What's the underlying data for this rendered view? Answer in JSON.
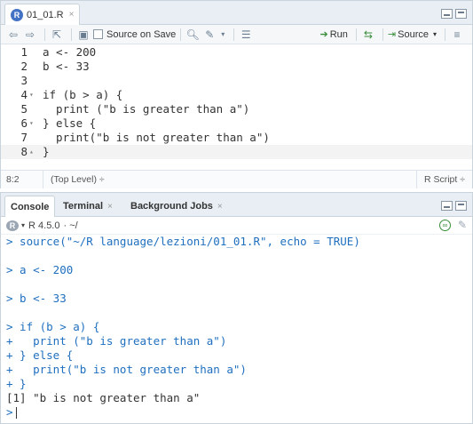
{
  "editor": {
    "tab_label": "01_01.R",
    "tab_close": "×",
    "toolbar": {
      "source_on_save_label": "Source on Save",
      "run_label": "Run",
      "source_label": "Source"
    },
    "lines": [
      {
        "num": "1",
        "fold": "",
        "text": "a <- 200"
      },
      {
        "num": "2",
        "fold": "",
        "text": "b <- 33"
      },
      {
        "num": "3",
        "fold": "",
        "text": ""
      },
      {
        "num": "4",
        "fold": "▾",
        "text": "if (b > a) {"
      },
      {
        "num": "5",
        "fold": "",
        "text": "  print (\"b is greater than a\")"
      },
      {
        "num": "6",
        "fold": "▾",
        "text": "} else {"
      },
      {
        "num": "7",
        "fold": "",
        "text": "  print(\"b is not greater than a\")"
      },
      {
        "num": "8",
        "fold": "▴",
        "text": "}"
      }
    ],
    "status": {
      "position": "8:2",
      "scope": "(Top Level) ÷",
      "file_type": "R Script ÷"
    }
  },
  "console": {
    "tabs": [
      {
        "label": "Console",
        "close": ""
      },
      {
        "label": "Terminal",
        "close": "×"
      },
      {
        "label": "Background Jobs",
        "close": "×"
      }
    ],
    "r_version": "R 4.5.0",
    "working_dir": "· ~/",
    "output": [
      "> source(\"~/R language/lezioni/01_01.R\", echo = TRUE)",
      "",
      "> a <- 200",
      "",
      "> b <- 33",
      "",
      "> if (b > a) {",
      "+   print (\"b is greater than a\")",
      "+ } else {",
      "+   print(\"b is not greater than a\")",
      "+ }",
      "[1] \"b is not greater than a\"",
      ">"
    ]
  },
  "colors": {
    "accent": "#1f6fbf",
    "pane_border": "#c9d3dc",
    "tabbar_bg": "#e8eef4"
  }
}
